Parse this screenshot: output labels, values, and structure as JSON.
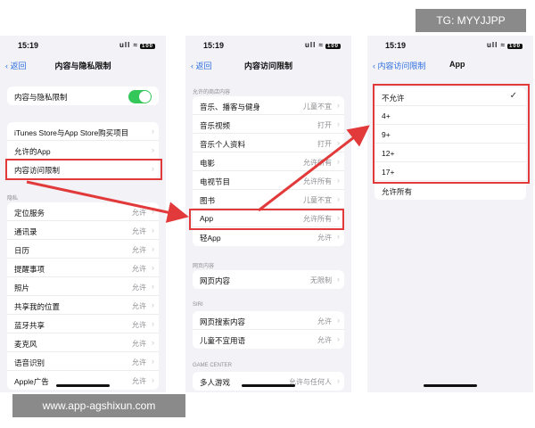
{
  "badges": {
    "tg": "TG: MYYJJPP",
    "site": "www.app-agshixun.com"
  },
  "status": {
    "time": "15:19",
    "signal": "ull ≈",
    "battery": "100"
  },
  "phone1": {
    "back": "返回",
    "title": "内容与隐私限制",
    "toggle_label": "内容与隐私限制",
    "toggle_on": true,
    "group2": [
      "iTunes Store与App Store购买项目",
      "允许的App",
      "内容访问限制"
    ],
    "privacy_header": "隐私",
    "privacy_rows": [
      {
        "label": "定位服务",
        "value": "允许"
      },
      {
        "label": "通讯录",
        "value": "允许"
      },
      {
        "label": "日历",
        "value": "允许"
      },
      {
        "label": "提醒事项",
        "value": "允许"
      },
      {
        "label": "照片",
        "value": "允许"
      },
      {
        "label": "共享我的位置",
        "value": "允许"
      },
      {
        "label": "蓝牙共享",
        "value": "允许"
      },
      {
        "label": "麦克风",
        "value": "允许"
      },
      {
        "label": "语音识别",
        "value": "允许"
      },
      {
        "label": "Apple广告",
        "value": "允许"
      }
    ]
  },
  "phone2": {
    "back": "返回",
    "title": "内容访问限制",
    "store_header": "允许的商店内容",
    "store_rows": [
      {
        "label": "音乐、播客与健身",
        "value": "儿童不宜"
      },
      {
        "label": "音乐视频",
        "value": "打开"
      },
      {
        "label": "音乐个人资料",
        "value": "打开"
      },
      {
        "label": "电影",
        "value": "允许所有"
      },
      {
        "label": "电视节目",
        "value": "允许所有"
      },
      {
        "label": "图书",
        "value": "儿童不宜"
      },
      {
        "label": "App",
        "value": "允许所有"
      },
      {
        "label": "轻App",
        "value": "允许"
      }
    ],
    "web_header": "网页内容",
    "web_rows": [
      {
        "label": "网页内容",
        "value": "无限制"
      }
    ],
    "siri_header": "SIRI",
    "siri_rows": [
      {
        "label": "网页搜索内容",
        "value": "允许"
      },
      {
        "label": "儿童不宜用语",
        "value": "允许"
      }
    ],
    "gc_header": "GAME CENTER",
    "gc_rows": [
      {
        "label": "多人游戏",
        "value": "允许与任何人"
      }
    ]
  },
  "phone3": {
    "back": "内容访问限制",
    "title": "App",
    "options": [
      "不允许",
      "4+",
      "9+",
      "12+",
      "17+"
    ],
    "selected": "不允许",
    "allow_all": "允许所有"
  },
  "colors": {
    "highlight": "#e23a3a",
    "toggle": "#34c759",
    "link": "#2f6fe0"
  }
}
